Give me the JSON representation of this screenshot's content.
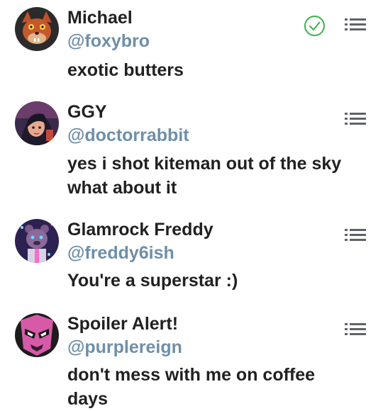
{
  "accounts": [
    {
      "name": "Michael",
      "handle": "@foxybro",
      "bio": "exotic butters",
      "avatar_icon": "fox-animatronic-avatar",
      "selected": true,
      "menu_icon": "drag-handle-icon"
    },
    {
      "name": "GGY",
      "handle": "@doctorrabbit",
      "bio": "yes i shot kiteman out of the sky what about it",
      "avatar_icon": "animated-girl-avatar",
      "selected": false,
      "menu_icon": "drag-handle-icon"
    },
    {
      "name": "Glamrock Freddy",
      "handle": "@freddy6ish",
      "bio": "You're a superstar :)",
      "avatar_icon": "glamrock-bear-avatar",
      "selected": false,
      "menu_icon": "drag-handle-icon"
    },
    {
      "name": "Spoiler Alert!",
      "handle": "@purplereign",
      "bio": "don't mess with me on coffee days",
      "avatar_icon": "masked-hero-avatar",
      "selected": false,
      "menu_icon": "drag-handle-icon"
    }
  ],
  "colors": {
    "name_text": "#212121",
    "handle_text": "#6e8fa8",
    "check_accent": "#3cb14a",
    "menu_icon": "#5f6368"
  }
}
